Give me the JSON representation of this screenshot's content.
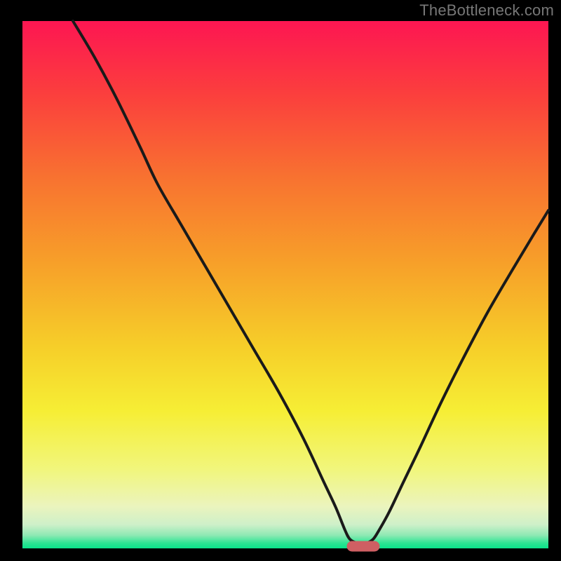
{
  "watermark": "TheBottleneck.com",
  "colors": {
    "frame": "#000000",
    "curve_stroke": "#1a1a1a",
    "marker_fill": "#cf5f63",
    "marker_stroke": "#cf5f63",
    "gradient_stops": [
      {
        "offset": 0.0,
        "color": "#fd1652"
      },
      {
        "offset": 0.14,
        "color": "#fb3f3d"
      },
      {
        "offset": 0.3,
        "color": "#f87330"
      },
      {
        "offset": 0.46,
        "color": "#f7a029"
      },
      {
        "offset": 0.62,
        "color": "#f6cf29"
      },
      {
        "offset": 0.74,
        "color": "#f6ee35"
      },
      {
        "offset": 0.85,
        "color": "#f1f67c"
      },
      {
        "offset": 0.92,
        "color": "#ebf4bd"
      },
      {
        "offset": 0.955,
        "color": "#cef0c9"
      },
      {
        "offset": 0.975,
        "color": "#8fe9b4"
      },
      {
        "offset": 0.99,
        "color": "#2de593"
      },
      {
        "offset": 1.0,
        "color": "#0ae38a"
      }
    ]
  },
  "chart_data": {
    "type": "line",
    "title": "",
    "xlabel": "",
    "ylabel": "",
    "xlim": [
      32,
      782
    ],
    "ylim": [
      30,
      782
    ],
    "marker": {
      "x": 495,
      "y": 772,
      "w": 46,
      "h": 14,
      "rx": 7
    },
    "curve_points": [
      [
        104,
        30
      ],
      [
        135,
        82
      ],
      [
        166,
        140
      ],
      [
        200,
        210
      ],
      [
        225,
        263
      ],
      [
        258,
        320
      ],
      [
        293,
        380
      ],
      [
        328,
        440
      ],
      [
        363,
        500
      ],
      [
        398,
        560
      ],
      [
        433,
        626
      ],
      [
        463,
        690
      ],
      [
        479,
        724
      ],
      [
        492,
        756
      ],
      [
        499,
        769
      ],
      [
        509,
        774
      ],
      [
        523,
        774
      ],
      [
        532,
        769
      ],
      [
        540,
        757
      ],
      [
        555,
        730
      ],
      [
        575,
        688
      ],
      [
        600,
        636
      ],
      [
        628,
        576
      ],
      [
        660,
        512
      ],
      [
        695,
        446
      ],
      [
        730,
        386
      ],
      [
        760,
        336
      ],
      [
        782,
        300
      ]
    ]
  }
}
